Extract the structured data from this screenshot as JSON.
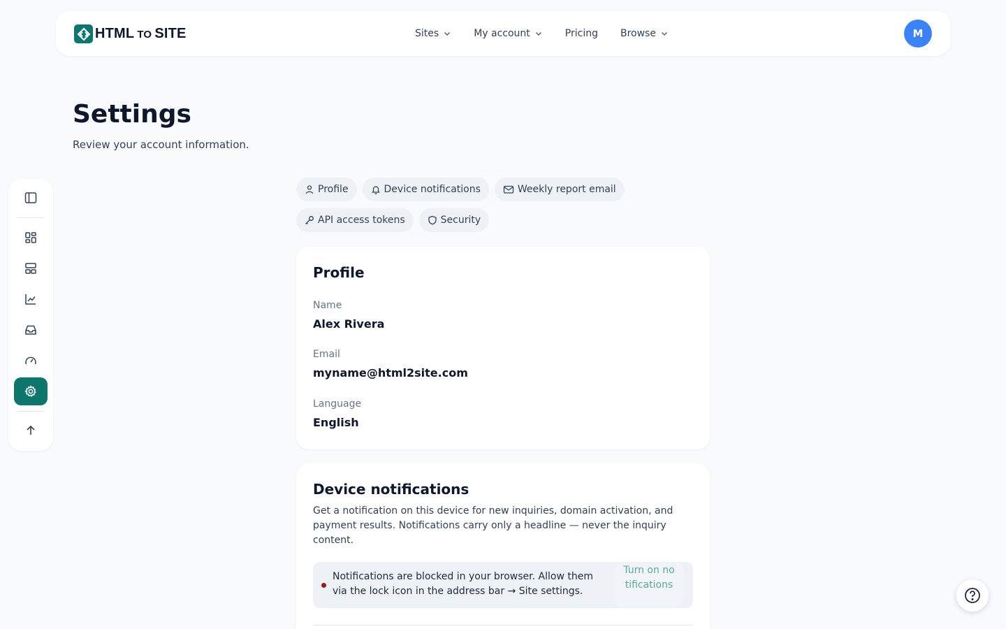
{
  "brand": {
    "name_left": "HTML",
    "name_mid": "TO",
    "name_right": "SITE",
    "accent": "#0f766e"
  },
  "nav": {
    "items": [
      {
        "label": "Sites",
        "has_menu": true
      },
      {
        "label": "My account",
        "has_menu": true
      },
      {
        "label": "Pricing",
        "has_menu": false
      },
      {
        "label": "Browse",
        "has_menu": true
      }
    ],
    "avatar_initial": "M",
    "avatar_color": "#3b82f6"
  },
  "page": {
    "title": "Settings",
    "subtitle": "Review your account information."
  },
  "rail": {
    "items": [
      {
        "icon": "sidebar-panel-icon"
      },
      {
        "icon": "dashboard-grid-icon"
      },
      {
        "icon": "layout-icon"
      },
      {
        "icon": "line-chart-icon"
      },
      {
        "icon": "inbox-icon"
      },
      {
        "icon": "gauge-icon"
      },
      {
        "icon": "gear-icon",
        "active": true
      },
      {
        "icon": "arrow-up-icon"
      }
    ]
  },
  "tabs": [
    {
      "label": "Profile",
      "icon": "user-icon"
    },
    {
      "label": "Device notifications",
      "icon": "bell-icon"
    },
    {
      "label": "Weekly report email",
      "icon": "mail-icon"
    },
    {
      "label": "API access tokens",
      "icon": "key-icon"
    },
    {
      "label": "Security",
      "icon": "shield-icon"
    }
  ],
  "profile": {
    "title": "Profile",
    "name_label": "Name",
    "name_value": "Alex Rivera",
    "email_label": "Email",
    "email_value": "myname@html2site.com",
    "language_label": "Language",
    "language_value": "English"
  },
  "notifications": {
    "title": "Device notifications",
    "description": "Get a notification on this device for new inquiries, domain activation, and payment results. Notifications carry only a headline — never the inquiry content.",
    "alert_text": "Notifications are blocked in your browser. Allow them via the lock icon in the address bar → Site settings.",
    "alert_button": "Turn on notifications",
    "alert_color": "#991b1b"
  },
  "help": {
    "icon": "help-circle-icon"
  }
}
